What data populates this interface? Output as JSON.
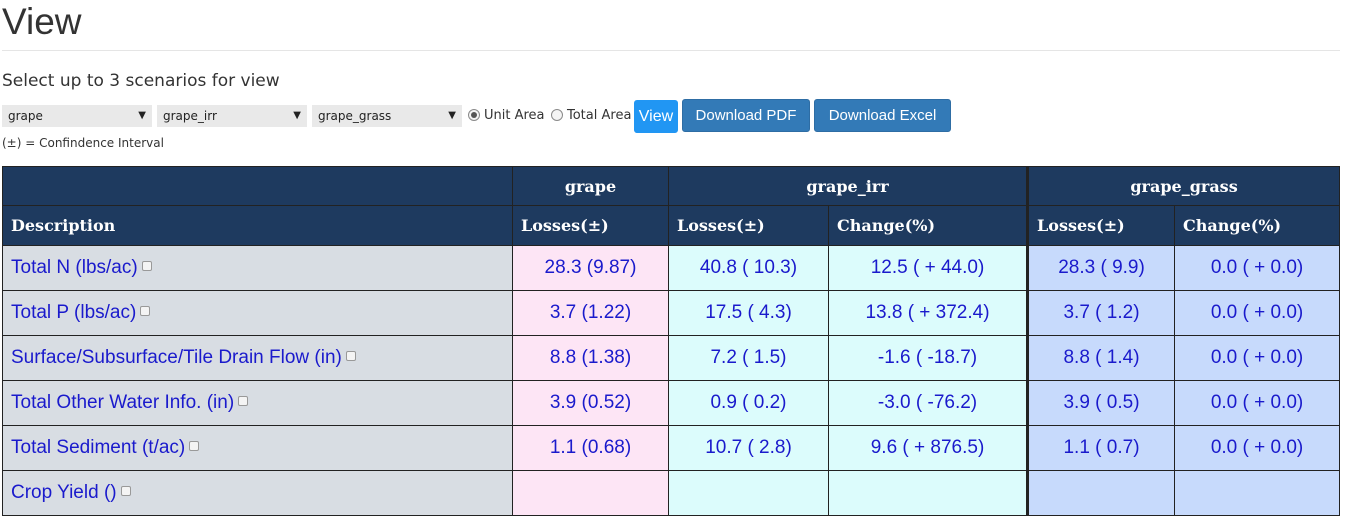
{
  "header": {
    "title": "View",
    "instructions": "Select up to 3 scenarios for view"
  },
  "controls": {
    "scenario_selects": [
      "grape",
      "grape_irr",
      "grape_grass"
    ],
    "area_options": [
      {
        "label": "Unit Area",
        "checked": true
      },
      {
        "label": "Total Area",
        "checked": false
      }
    ],
    "view_label": "View",
    "download_pdf_label": "Download PDF",
    "download_excel_label": "Download Excel",
    "note": "(±) = Confindence Interval"
  },
  "table": {
    "scenario_headers": [
      "grape",
      "grape_irr",
      "grape_grass"
    ],
    "column_headers": [
      "Description",
      "Losses(±)",
      "Losses(±)",
      "Change(%)",
      "Losses(±)",
      "Change(%)"
    ],
    "rows": [
      {
        "description": "Total N (lbs/ac)",
        "grape_losses": "28.3 (9.87)",
        "irr_losses": "40.8 ( 10.3)",
        "irr_change": "12.5 ( + 44.0)",
        "grass_losses": "28.3 ( 9.9)",
        "grass_change": "0.0 ( + 0.0)"
      },
      {
        "description": "Total P (lbs/ac)",
        "grape_losses": "3.7 (1.22)",
        "irr_losses": "17.5 ( 4.3)",
        "irr_change": "13.8 ( + 372.4)",
        "grass_losses": "3.7 ( 1.2)",
        "grass_change": "0.0 ( + 0.0)"
      },
      {
        "description": "Surface/Subsurface/Tile Drain Flow (in)",
        "grape_losses": "8.8 (1.38)",
        "irr_losses": "7.2 ( 1.5)",
        "irr_change": "-1.6 ( -18.7)",
        "grass_losses": "8.8 ( 1.4)",
        "grass_change": "0.0 ( + 0.0)"
      },
      {
        "description": "Total Other Water Info. (in)",
        "grape_losses": "3.9 (0.52)",
        "irr_losses": "0.9 ( 0.2)",
        "irr_change": "-3.0 ( -76.2)",
        "grass_losses": "3.9 ( 0.5)",
        "grass_change": "0.0 ( + 0.0)"
      },
      {
        "description": "Total Sediment (t/ac)",
        "grape_losses": "1.1 (0.68)",
        "irr_losses": "10.7 ( 2.8)",
        "irr_change": "9.6 ( + 876.5)",
        "grass_losses": "1.1 ( 0.7)",
        "grass_change": "0.0 ( + 0.0)"
      },
      {
        "description": "Crop Yield ()",
        "grape_losses": "",
        "irr_losses": "",
        "irr_change": "",
        "grass_losses": "",
        "grass_change": ""
      }
    ]
  },
  "icons": {
    "select_arrow": "chevron-down-icon",
    "row_checkbox": "checkbox-icon"
  },
  "colors": {
    "header_bg": "#1e3a5f",
    "desc_bg": "#d8dde3",
    "grape_bg": "#fde5f5",
    "irr_bg": "#dcfcfc",
    "grass_bg": "#c7dafc",
    "link_text": "#1a1acc",
    "view_button": "#2196f3",
    "download_button": "#337ab7"
  }
}
